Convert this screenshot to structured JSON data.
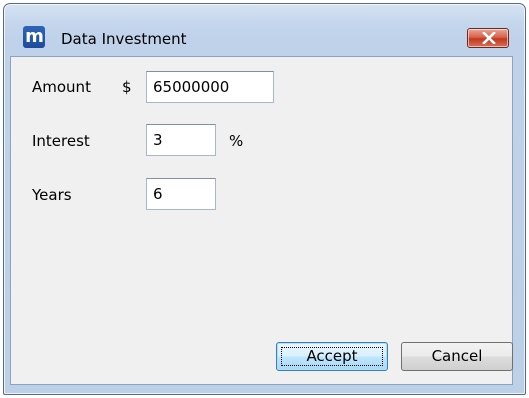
{
  "window": {
    "title": "Data Investment",
    "app_icon_glyph": "m",
    "accent_color": "#2f64b8"
  },
  "form": {
    "amount": {
      "label": "Amount",
      "prefix": "$",
      "value": "65000000"
    },
    "interest": {
      "label": "Interest",
      "value": "3",
      "suffix": "%"
    },
    "years": {
      "label": "Years",
      "value": "6"
    }
  },
  "buttons": {
    "accept_label": "Accept",
    "cancel_label": "Cancel"
  }
}
